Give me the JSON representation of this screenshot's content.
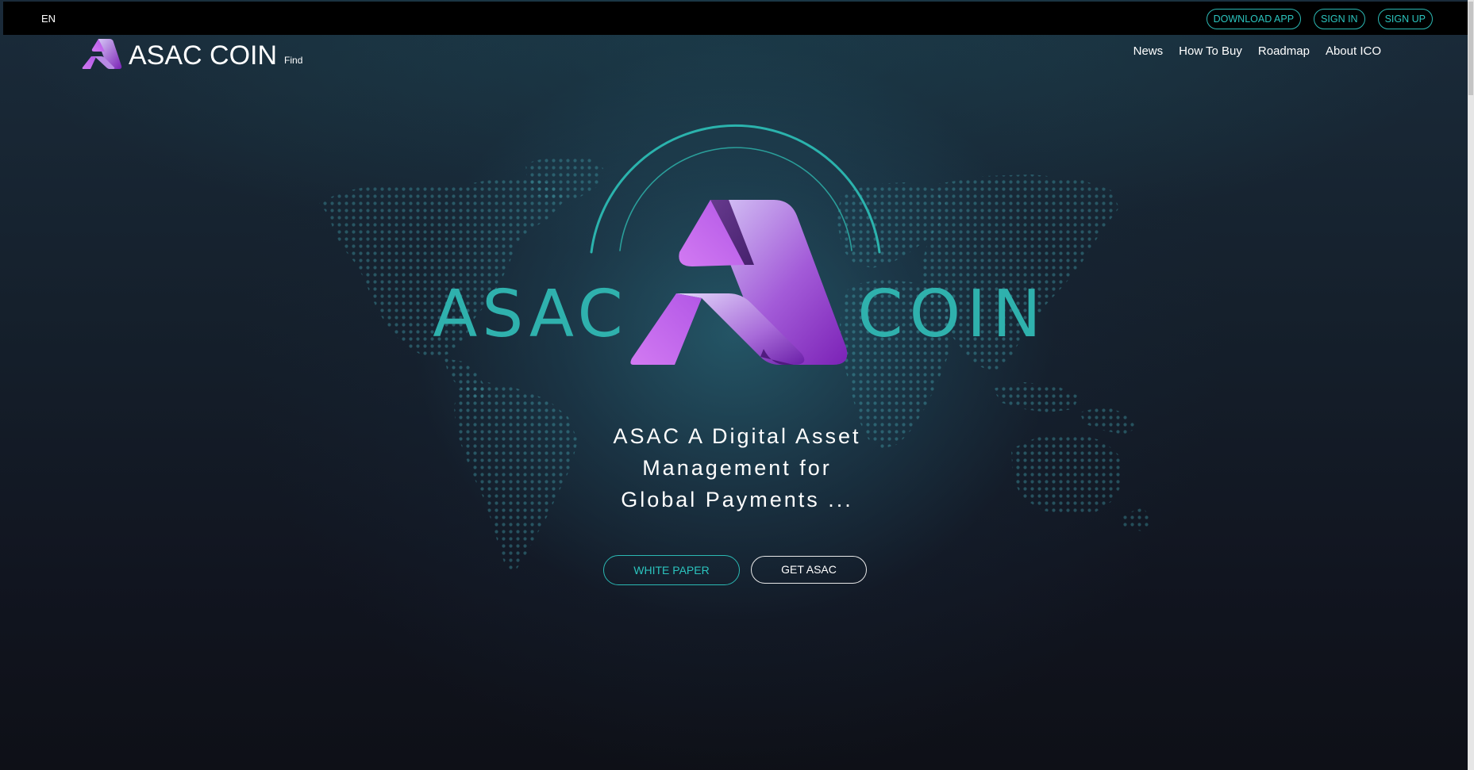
{
  "lang": "EN",
  "top_actions": {
    "download": "DOWNLOAD APP",
    "signin": "SIGN IN",
    "signup": "SIGN UP"
  },
  "brand": {
    "title": "ASAC COIN",
    "sub": "Find"
  },
  "nav": {
    "news": "News",
    "how_to_buy": "How To Buy",
    "roadmap": "Roadmap",
    "about": "About ICO"
  },
  "hero": {
    "logo_left": "ASAC",
    "logo_right": "COIN",
    "tagline_lines": [
      "ASAC A Digital Asset",
      "Management for",
      "Global Payments ..."
    ],
    "white_paper": "WHITE PAPER",
    "get_asac": "GET ASAC"
  },
  "colors": {
    "accent": "#2bb8b3",
    "logo_purple": "#a44ee0",
    "background": "#111520"
  },
  "icons": {
    "logo": "asac-a-logo-icon",
    "world_map": "dotted-world-map"
  }
}
